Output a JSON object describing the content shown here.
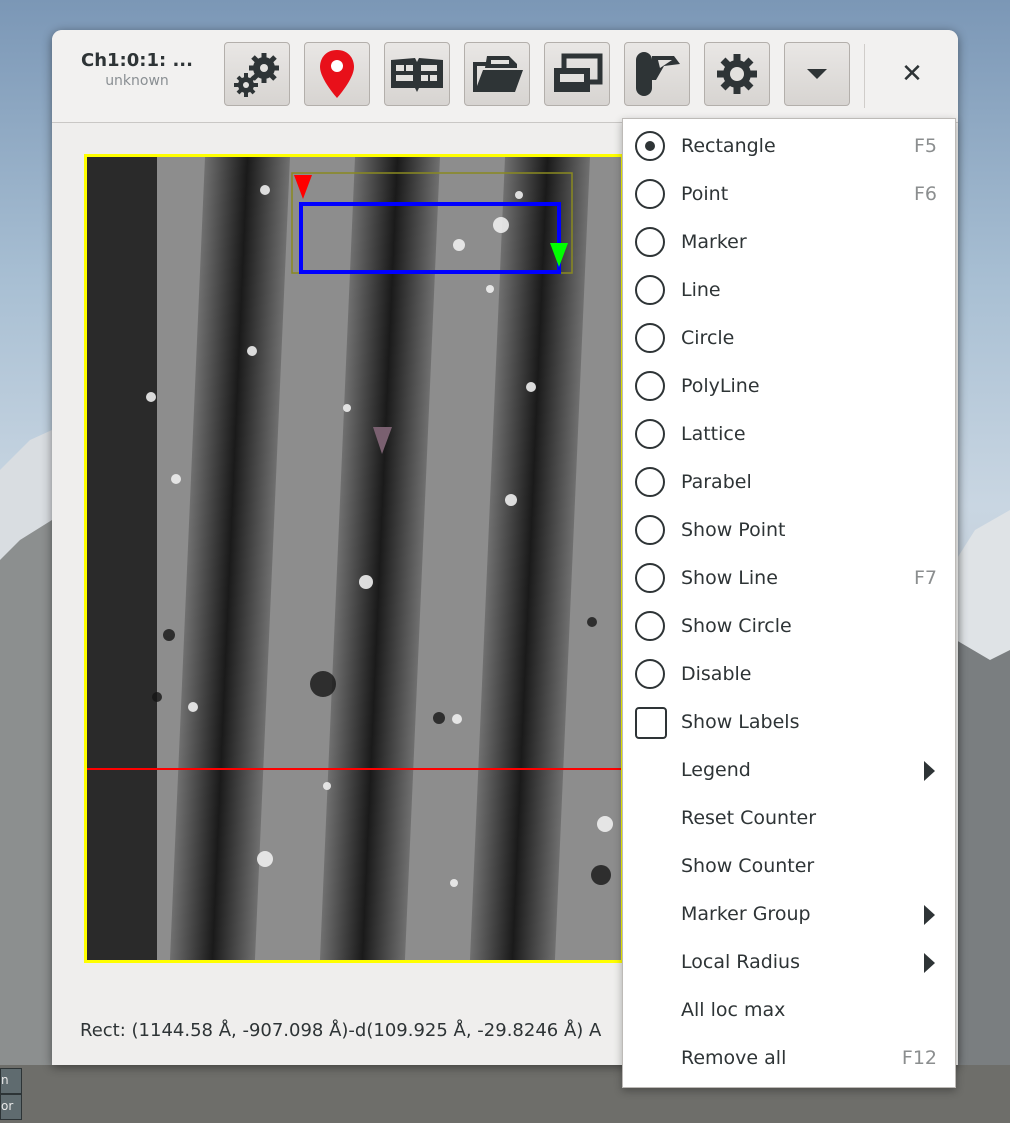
{
  "window": {
    "title": "Ch1:0:1: ...",
    "subtitle": "unknown"
  },
  "toolbar": {
    "buttons": [
      {
        "icon": "gears-icon"
      },
      {
        "icon": "map-pin-icon"
      },
      {
        "icon": "book-icon"
      },
      {
        "icon": "open-folder-icon"
      },
      {
        "icon": "windows-icon"
      },
      {
        "icon": "tool-icon"
      },
      {
        "icon": "gear-icon"
      },
      {
        "icon": "chevron-down-icon"
      }
    ],
    "close_icon": "close-icon",
    "close_glyph": "✕"
  },
  "status": {
    "text": "Rect: (1144.58 Å, -907.098 Å)-d(109.925 Å, -29.8246 Å) A"
  },
  "menu": {
    "items": [
      {
        "type": "radio",
        "label": "Rectangle",
        "accel": "F5",
        "checked": true
      },
      {
        "type": "radio",
        "label": "Point",
        "accel": "F6",
        "checked": false
      },
      {
        "type": "radio",
        "label": "Marker",
        "accel": "",
        "checked": false
      },
      {
        "type": "radio",
        "label": "Line",
        "accel": "",
        "checked": false
      },
      {
        "type": "radio",
        "label": "Circle",
        "accel": "",
        "checked": false
      },
      {
        "type": "radio",
        "label": "PolyLine",
        "accel": "",
        "checked": false
      },
      {
        "type": "radio",
        "label": "Lattice",
        "accel": "",
        "checked": false
      },
      {
        "type": "radio",
        "label": "Parabel",
        "accel": "",
        "checked": false
      },
      {
        "type": "radio",
        "label": "Show Point",
        "accel": "",
        "checked": false
      },
      {
        "type": "radio",
        "label": "Show Line",
        "accel": "F7",
        "checked": false
      },
      {
        "type": "radio",
        "label": "Show Circle",
        "accel": "",
        "checked": false
      },
      {
        "type": "radio",
        "label": "Disable",
        "accel": "",
        "checked": false
      },
      {
        "type": "check",
        "label": "Show Labels",
        "accel": "",
        "checked": false
      },
      {
        "type": "submenu",
        "label": "Legend",
        "accel": ""
      },
      {
        "type": "plain",
        "label": "Reset Counter",
        "accel": ""
      },
      {
        "type": "plain",
        "label": "Show Counter",
        "accel": ""
      },
      {
        "type": "submenu",
        "label": "Marker Group",
        "accel": ""
      },
      {
        "type": "submenu",
        "label": "Local Radius",
        "accel": ""
      },
      {
        "type": "plain",
        "label": "All loc max",
        "accel": ""
      },
      {
        "type": "plain",
        "label": "Remove all",
        "accel": "F12"
      }
    ]
  },
  "taskbar": {
    "items": [
      "n",
      "or"
    ]
  },
  "colors": {
    "selection_border": "#ffff00",
    "rect_marker": "#0000ff",
    "scan_line": "#ff0000"
  }
}
